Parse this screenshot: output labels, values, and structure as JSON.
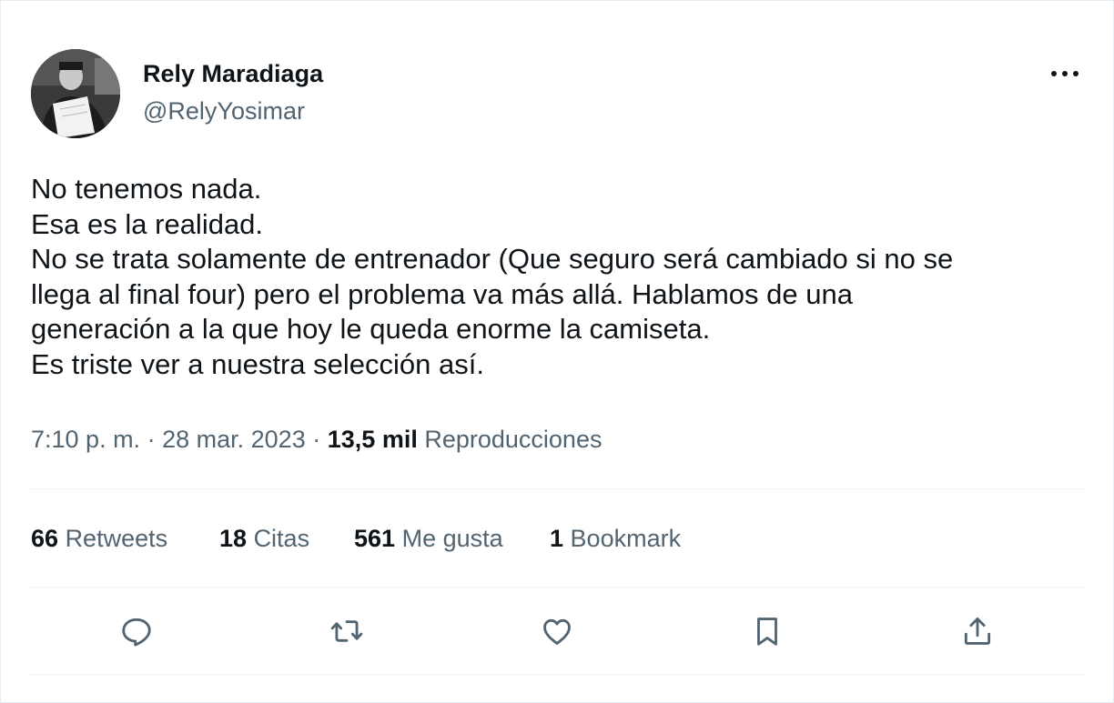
{
  "tweet": {
    "author": {
      "name": "Rely Maradiaga",
      "handle": "@RelyYosimar",
      "avatar_icon": "avatar-photo"
    },
    "more_icon": "more-options-icon",
    "text_lines": [
      "No tenemos nada.",
      "Esa es la realidad.",
      "No se trata solamente de entrenador (Que seguro será cambiado si no se",
      "llega al final four) pero el problema va más allá. Hablamos de una",
      "generación a la que hoy le queda enorme la camiseta.",
      "Es triste ver a nuestra selección así."
    ],
    "meta": {
      "time": "7:10 p. m.",
      "separator": "·",
      "date": "28 mar. 2023",
      "views_count": "13,5 mil",
      "views_label": "Reproducciones"
    },
    "stats": {
      "retweets": {
        "count": "66",
        "label": "Retweets"
      },
      "quotes": {
        "count": "18",
        "label": "Citas"
      },
      "likes": {
        "count": "561",
        "label": "Me gusta"
      },
      "bookmarks": {
        "count": "1",
        "label": "Bookmark"
      }
    },
    "actions": {
      "reply_icon": "reply-icon",
      "retweet_icon": "retweet-icon",
      "like_icon": "heart-icon",
      "bookmark_icon": "bookmark-icon",
      "share_icon": "share-icon"
    }
  },
  "colors": {
    "text_primary": "#0f1419",
    "text_secondary": "#536471",
    "divider": "#eff3f4"
  }
}
